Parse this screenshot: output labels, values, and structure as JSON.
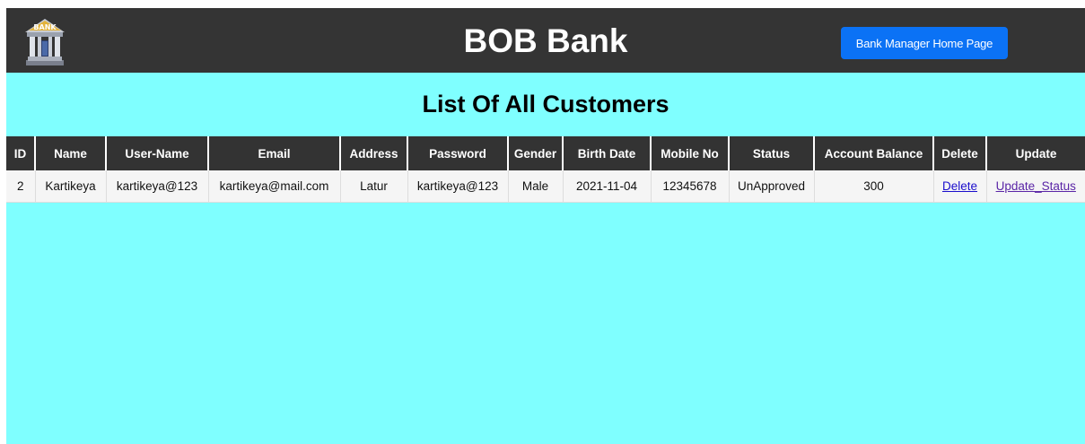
{
  "header": {
    "logo_icon": "bank-building-icon",
    "logo_text": "BANK",
    "title": "BOB Bank",
    "home_button_label": "Bank Manager Home Page"
  },
  "main": {
    "heading": "List Of All Customers"
  },
  "table": {
    "columns": [
      "ID",
      "Name",
      "User-Name",
      "Email",
      "Address",
      "Password",
      "Gender",
      "Birth Date",
      "Mobile No",
      "Status",
      "Account Balance",
      "Delete",
      "Update"
    ],
    "rows": [
      {
        "id": "2",
        "name": "Kartikeya",
        "username": "kartikeya@123",
        "email": "kartikeya@mail.com",
        "address": "Latur",
        "password": "kartikeya@123",
        "gender": "Male",
        "birth_date": "2021-11-04",
        "mobile": "12345678",
        "status": "UnApproved",
        "balance": "300",
        "delete_link": "Delete",
        "update_link": "Update_Status"
      }
    ]
  },
  "colors": {
    "navbar": "#343434",
    "page_background": "#7fffff",
    "button": "#0b72f5",
    "table_header": "#333333"
  }
}
